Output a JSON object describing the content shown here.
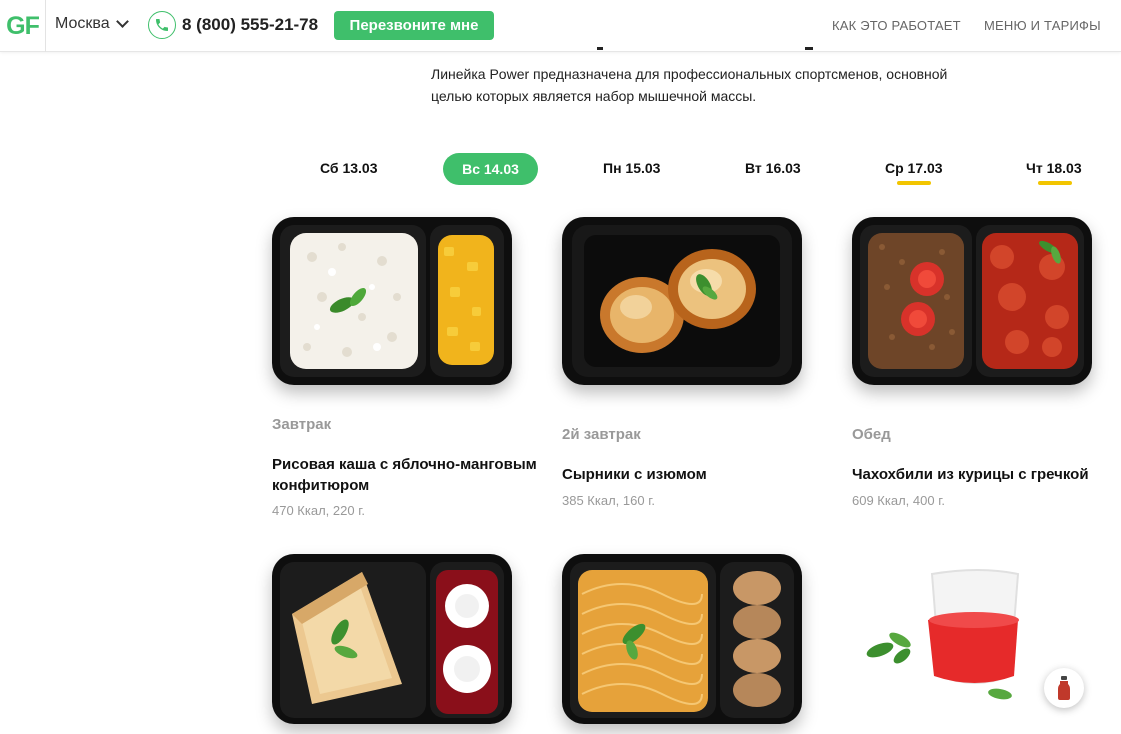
{
  "header": {
    "logo": "GF",
    "city": "Москва",
    "phone": "8 (800) 555-21-78",
    "callback_label": "Перезвоните мне",
    "nav": [
      {
        "label": "КАК ЭТО РАБОТАЕТ"
      },
      {
        "label": "МЕНЮ И ТАРИФЫ"
      }
    ]
  },
  "description": "Линейка Power предназначена для профессиональных спортсменов, основной целью которых является набор мышечной массы.",
  "days": [
    {
      "label": "Сб 13.03",
      "active": false,
      "underlined": false
    },
    {
      "label": "Вс 14.03",
      "active": true,
      "underlined": false
    },
    {
      "label": "Пн 15.03",
      "active": false,
      "underlined": false
    },
    {
      "label": "Вт 16.03",
      "active": false,
      "underlined": false
    },
    {
      "label": "Ср 17.03",
      "active": false,
      "underlined": true
    },
    {
      "label": "Чт 18.03",
      "active": false,
      "underlined": true
    }
  ],
  "meals": [
    {
      "type": "Завтрак",
      "name": "Рисовая каша с яблочно-манговым конфитюром",
      "info": "470 Ккал, 220 г."
    },
    {
      "type": "2й завтрак",
      "name": "Сырники с изюмом",
      "info": "385 Ккал, 160 г."
    },
    {
      "type": "Обед",
      "name": "Чахохбили из курицы с гречкой",
      "info": "609 Ккал, 400 г."
    }
  ],
  "colors": {
    "accent": "#3fbf6b",
    "underline": "#f2c500"
  },
  "icons": {
    "phone": "phone-icon",
    "city_dropdown": "chevron-down-icon",
    "float_button": "juice-bottle-icon"
  }
}
